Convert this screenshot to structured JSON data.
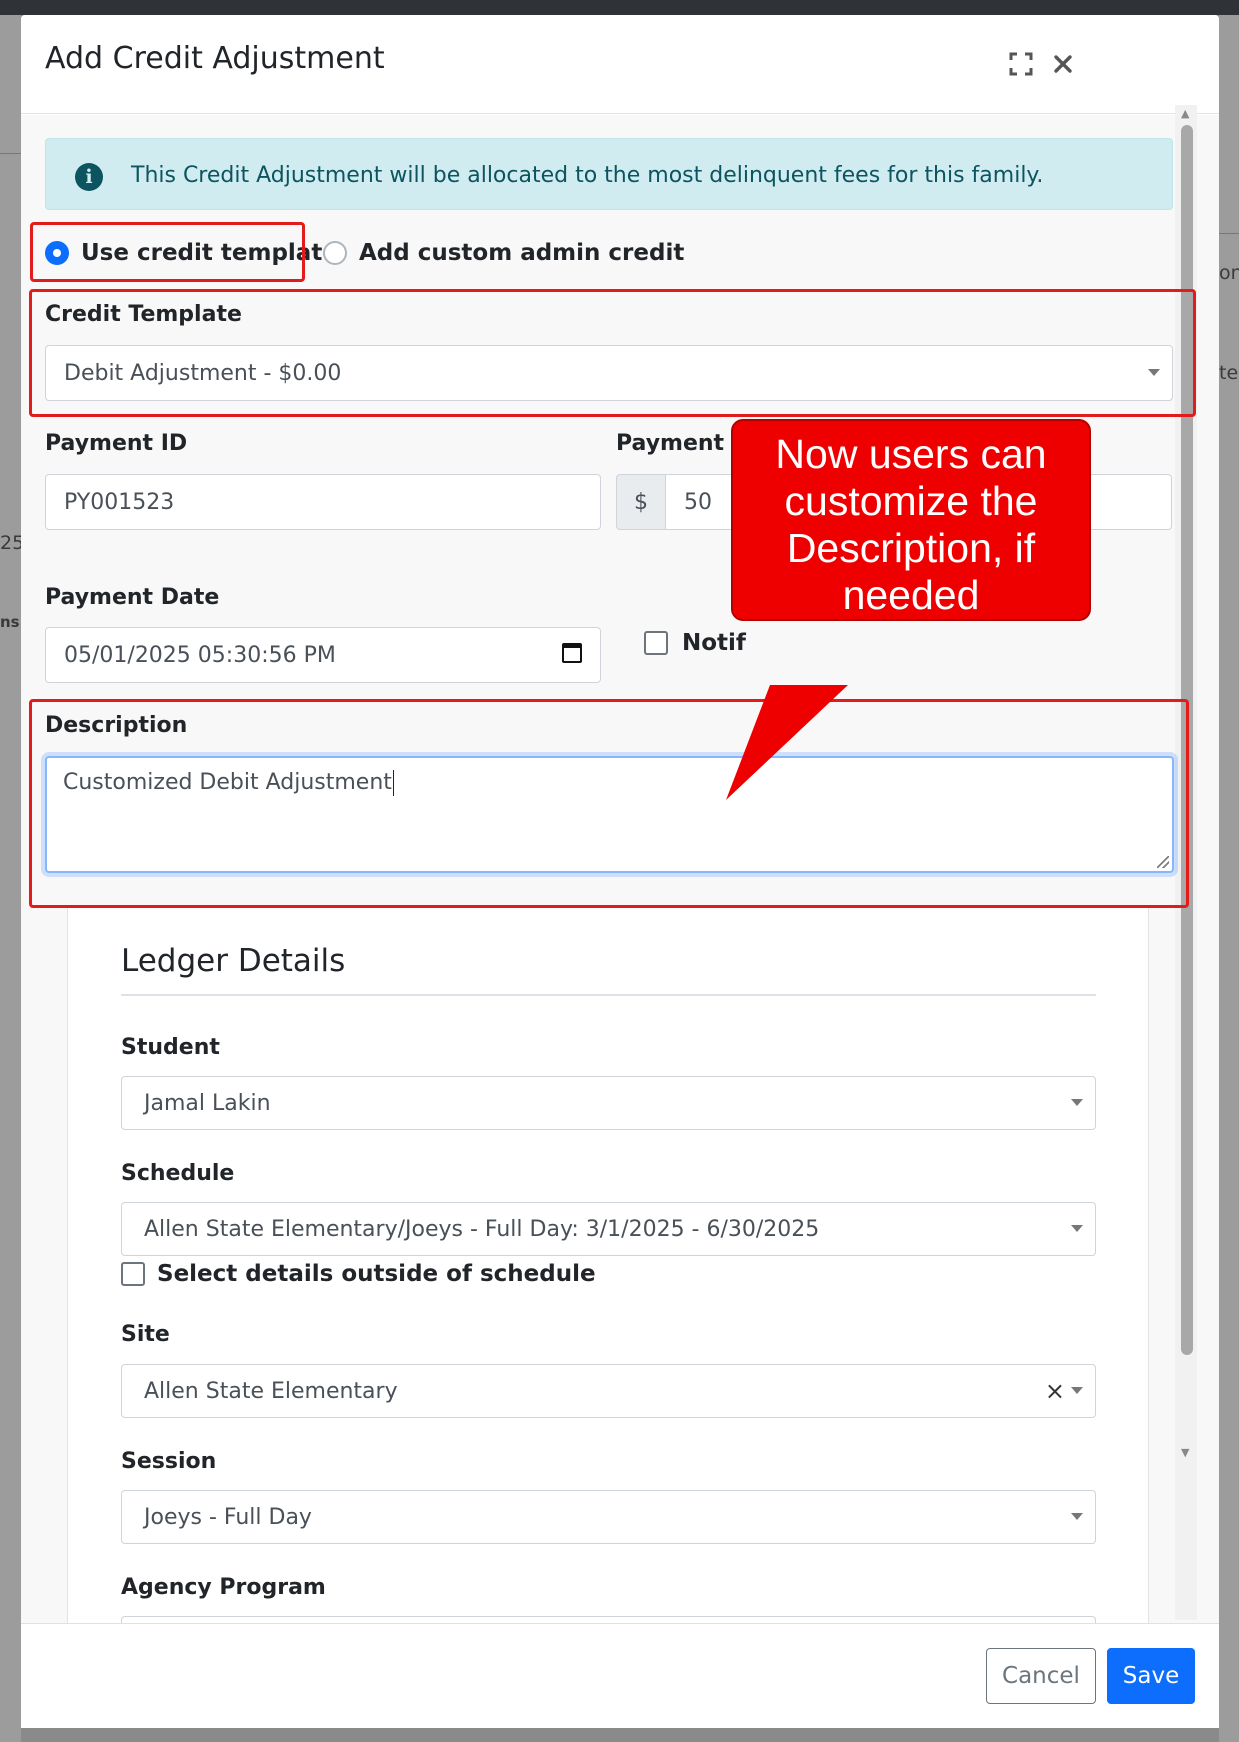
{
  "modal": {
    "title": "Add Credit Adjustment",
    "expand_icon": "expand-icon",
    "close_icon": "close-icon"
  },
  "background_fragments": [
    "on",
    "te",
    "25",
    "ns"
  ],
  "alert": {
    "icon": "info-icon",
    "text": "This Credit Adjustment will be allocated to the most delinquent fees for this family."
  },
  "mode": {
    "options": [
      {
        "label": "Use credit template",
        "selected": true
      },
      {
        "label": "Add custom admin credit",
        "selected": false
      }
    ]
  },
  "credit_template": {
    "label": "Credit Template",
    "value": "Debit Adjustment - $0.00"
  },
  "payment_id": {
    "label": "Payment ID",
    "value": "PY001523"
  },
  "payment_amount": {
    "label": "Payment Amount",
    "currency": "$",
    "value": "50"
  },
  "payment_date": {
    "label": "Payment Date",
    "value": "05/01/2025 05:30:56 PM"
  },
  "notify": {
    "label_partial": "Notif"
  },
  "description": {
    "label": "Description",
    "value": "Customized Debit Adjustment"
  },
  "ledger": {
    "title": "Ledger Details",
    "student": {
      "label": "Student",
      "value": "Jamal Lakin"
    },
    "schedule": {
      "label": "Schedule",
      "value": "Allen State Elementary/Joeys - Full Day: 3/1/2025 - 6/30/2025"
    },
    "outside_schedule": {
      "label": "Select details outside of schedule",
      "checked": false
    },
    "site": {
      "label": "Site",
      "value": "Allen State Elementary",
      "clear": "×"
    },
    "session": {
      "label": "Session",
      "value": "Joeys - Full Day"
    },
    "agency_program": {
      "label": "Agency Program"
    }
  },
  "footer": {
    "cancel": "Cancel",
    "save": "Save"
  },
  "annotation": {
    "text_lines": [
      "Now users can",
      "customize the",
      "Description, if",
      "needed"
    ],
    "color": "#ee0000"
  },
  "colors": {
    "primary": "#0d6efd",
    "alert_bg": "#d1ecf1",
    "alert_text": "#0c5460",
    "highlight": "#e41b1b"
  }
}
